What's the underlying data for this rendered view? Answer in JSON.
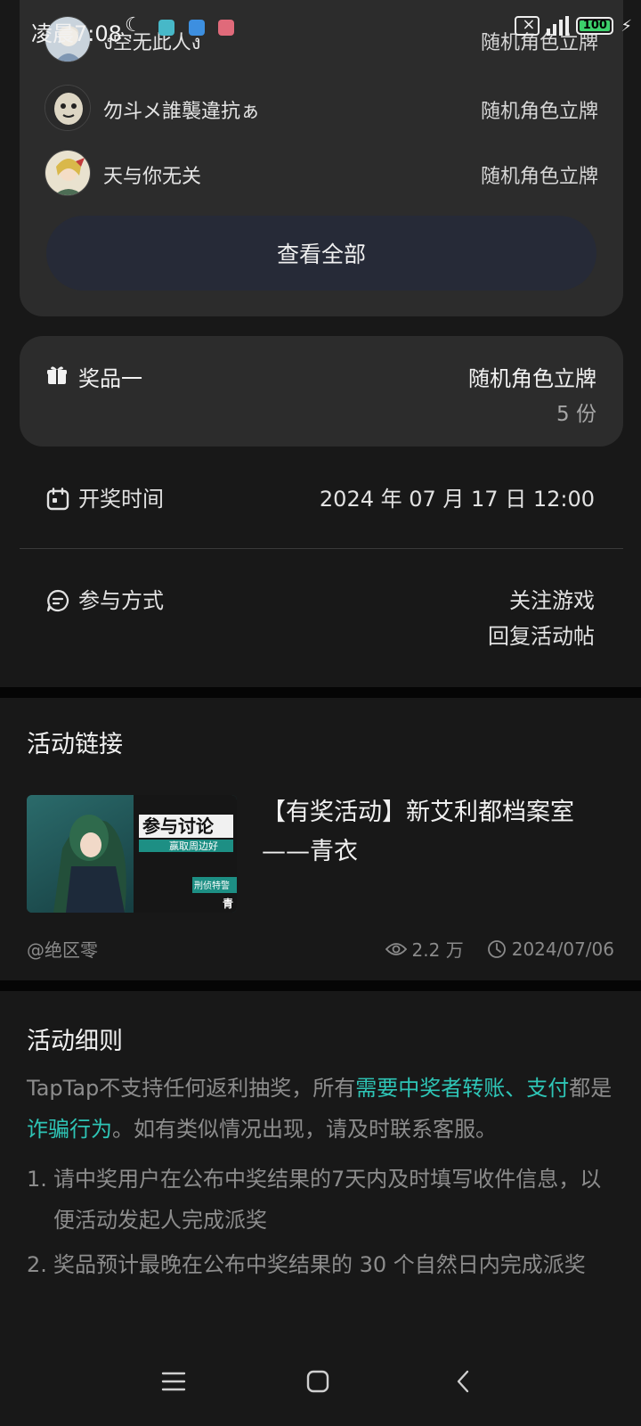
{
  "status_bar": {
    "time": "凌晨7:08",
    "battery": "100"
  },
  "participants": [
    {
      "name": "ง空无此人ง",
      "prize": "随机角色立牌"
    },
    {
      "name": "勿斗メ誰襲違抗ぁ",
      "prize": "随机角色立牌"
    },
    {
      "name": "天与你无关",
      "prize": "随机角色立牌"
    }
  ],
  "view_all_label": "查看全部",
  "prize": {
    "label": "奖品一",
    "name": "随机角色立牌",
    "count": "5 份"
  },
  "draw_time": {
    "label": "开奖时间",
    "value": "2024 年 07 月 17 日 12:00"
  },
  "participation": {
    "label": "参与方式",
    "methods": [
      "关注游戏",
      "回复活动帖"
    ]
  },
  "activity_link": {
    "section_title": "活动链接",
    "post_title": "【有奖活动】新艾利都档案室——青衣",
    "thumbnail_text": "参与讨论",
    "thumbnail_sub": "赢取周边好",
    "thumbnail_tag": "刑侦特警",
    "thumbnail_char": "青",
    "author": "@绝区零",
    "views": "2.2 万",
    "date": "2024/07/06"
  },
  "rules": {
    "section_title": "活动细则",
    "intro_1": "TapTap不支持任何返利抽奖，所有",
    "intro_hl_1": "需要中奖者转账、支付",
    "intro_2": "都是",
    "intro_hl_2": "诈骗行为",
    "intro_3": "。如有类似情况出现，请及时联系客服。",
    "items": [
      {
        "num": "1.",
        "text": "请中奖用户在公布中奖结果的7天内及时填写收件信息，以便活动发起人完成派奖"
      },
      {
        "num": "2.",
        "text": "奖品预计最晚在公布中奖结果的 30 个自然日内完成派奖"
      }
    ]
  },
  "colors": {
    "accent": "#2ec5b6",
    "card_bg": "#2c2c2c",
    "page_bg": "#181818",
    "button_bg": "#262a37"
  },
  "icons": [
    "gift-icon",
    "calendar-icon",
    "chat-icon",
    "eye-icon",
    "clock-icon",
    "menu-icon",
    "home-icon",
    "back-icon"
  ]
}
